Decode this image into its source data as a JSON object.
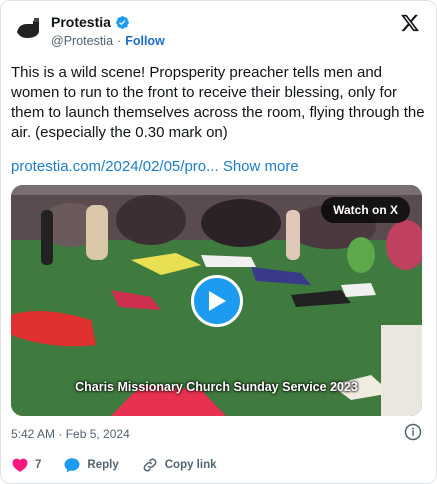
{
  "author": {
    "name": "Protestia",
    "handle": "@Protestia",
    "separator": "·",
    "follow_label": "Follow"
  },
  "tweet": {
    "text": "This is a wild scene! Propsperity preacher tells men and women to run to the front to receive their blessing, only for them to launch themselves across the room, flying through the air. (especially the 0.30 mark on)",
    "link_text": "protestia.com/2024/02/05/pro...",
    "show_more": "Show more"
  },
  "media": {
    "watch_label": "Watch on X",
    "caption": "Charis Missionary Church Sunday Service 2023"
  },
  "timestamp": "5:42 AM · Feb 5, 2024",
  "actions": {
    "like_count": "7",
    "reply_label": "Reply",
    "copy_link_label": "Copy link"
  },
  "colors": {
    "like": "#f91880",
    "reply": "#1d9bf0",
    "link": "#1d7ec8",
    "verified": "#1d9bf0"
  }
}
